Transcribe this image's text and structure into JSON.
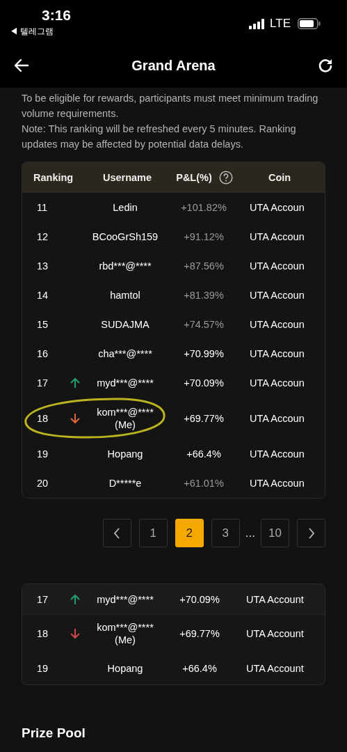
{
  "status_bar": {
    "time": "3:16",
    "back_app": "◀ 텔레그램",
    "network": "LTE"
  },
  "header": {
    "title": "Grand Arena"
  },
  "notes": [
    "To be eligible for rewards, participants must meet minimum trading volume requirements.",
    "Note: This ranking will be refreshed every 5 minutes. Ranking updates may be affected by potential data delays."
  ],
  "ranking_table": {
    "columns": [
      "Ranking",
      "Username",
      "P&L(%)",
      "Coin"
    ],
    "rows": [
      {
        "rank": "11",
        "moved_up": false,
        "moved_down": false,
        "username": "Ledin",
        "pnl": "+101.82%",
        "dimmed": true,
        "coin": "UTA Accoun"
      },
      {
        "rank": "12",
        "moved_up": false,
        "moved_down": false,
        "username": "BCooGrSh159",
        "pnl": "+91.12%",
        "dimmed": true,
        "coin": "UTA Accoun"
      },
      {
        "rank": "13",
        "moved_up": false,
        "moved_down": false,
        "username": "rbd***@****",
        "pnl": "+87.56%",
        "dimmed": true,
        "coin": "UTA Accoun"
      },
      {
        "rank": "14",
        "moved_up": false,
        "moved_down": false,
        "username": "hamtol",
        "pnl": "+81.39%",
        "dimmed": true,
        "coin": "UTA Accoun"
      },
      {
        "rank": "15",
        "moved_up": false,
        "moved_down": false,
        "username": "SUDAJMA",
        "pnl": "+74.57%",
        "dimmed": true,
        "coin": "UTA Accoun"
      },
      {
        "rank": "16",
        "moved_up": false,
        "moved_down": false,
        "username": "cha***@****",
        "pnl": "+70.99%",
        "dimmed": false,
        "coin": "UTA Accoun"
      },
      {
        "rank": "17",
        "moved_up": true,
        "moved_down": false,
        "username": "myd***@****",
        "pnl": "+70.09%",
        "dimmed": false,
        "coin": "UTA Accoun"
      },
      {
        "rank": "18",
        "moved_up": false,
        "moved_down": true,
        "username": "kom***@****",
        "me": "(Me)",
        "pnl": "+69.77%",
        "dimmed": false,
        "coin": "UTA Accoun"
      },
      {
        "rank": "19",
        "moved_up": false,
        "moved_down": false,
        "username": "Hopang",
        "pnl": "+66.4%",
        "dimmed": false,
        "coin": "UTA Accoun"
      },
      {
        "rank": "20",
        "moved_up": false,
        "moved_down": false,
        "username": "D*****e",
        "pnl": "+61.01%",
        "dimmed": true,
        "coin": "UTA Accoun"
      }
    ]
  },
  "pagination": [
    {
      "kind": "prev"
    },
    {
      "kind": "page",
      "label": "1",
      "selected": false
    },
    {
      "kind": "page",
      "label": "2",
      "selected": true
    },
    {
      "kind": "page",
      "label": "3",
      "selected": false
    },
    {
      "kind": "ellipsis",
      "label": "..."
    },
    {
      "kind": "page",
      "label": "10",
      "selected": false
    },
    {
      "kind": "next"
    }
  ],
  "my_position": {
    "rows": [
      {
        "rank": "17",
        "moved_up": true,
        "moved_down": false,
        "username": "myd***@****",
        "pnl": "+70.09%",
        "coin": "UTA Account"
      },
      {
        "rank": "18",
        "moved_up": false,
        "moved_down": true,
        "username": "kom***@****",
        "me": "(Me)",
        "pnl": "+69.77%",
        "coin": "UTA Account"
      },
      {
        "rank": "19",
        "moved_up": false,
        "moved_down": false,
        "username": "Hopang",
        "pnl": "+66.4%",
        "coin": "UTA Account"
      }
    ]
  },
  "prize_pool": {
    "title": "Prize Pool"
  }
}
